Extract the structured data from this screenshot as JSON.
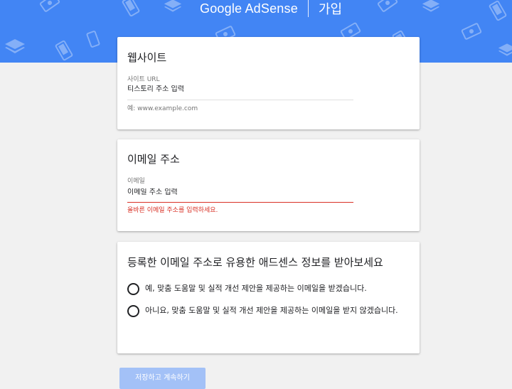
{
  "header": {
    "brand_name": "Google AdSense",
    "action": "가입",
    "band_color": "#4285f4"
  },
  "site_card": {
    "title": "웹사이트",
    "url_label": "사이트 URL",
    "url_placeholder": "티스토리 주소 입력",
    "url_hint": "예: www.example.com"
  },
  "email_card": {
    "title": "이메일 주소",
    "email_label": "이메일",
    "email_placeholder": "이메일 주소 입력",
    "email_error": "올바른 이메일 주소를 입력하세요.",
    "error_color": "#d93025"
  },
  "newsletter_card": {
    "title": "등록한 이메일 주소로 유용한 애드센스 정보를 받아보세요",
    "options": [
      {
        "label": "예, 맞춤 도움말 및 실적 개선 제안을 제공하는 이메일을 받겠습니다.",
        "selected": false
      },
      {
        "label": "아니요, 맞춤 도움말 및 실적 개선 제안을 제공하는 이메일을 받지 않겠습니다.",
        "selected": false
      }
    ]
  },
  "footer": {
    "submit_label": "저장하고 계속하기",
    "submit_state": "disabled"
  },
  "decorations": [
    "banknote-icon",
    "layers-icon",
    "phone-icon"
  ]
}
